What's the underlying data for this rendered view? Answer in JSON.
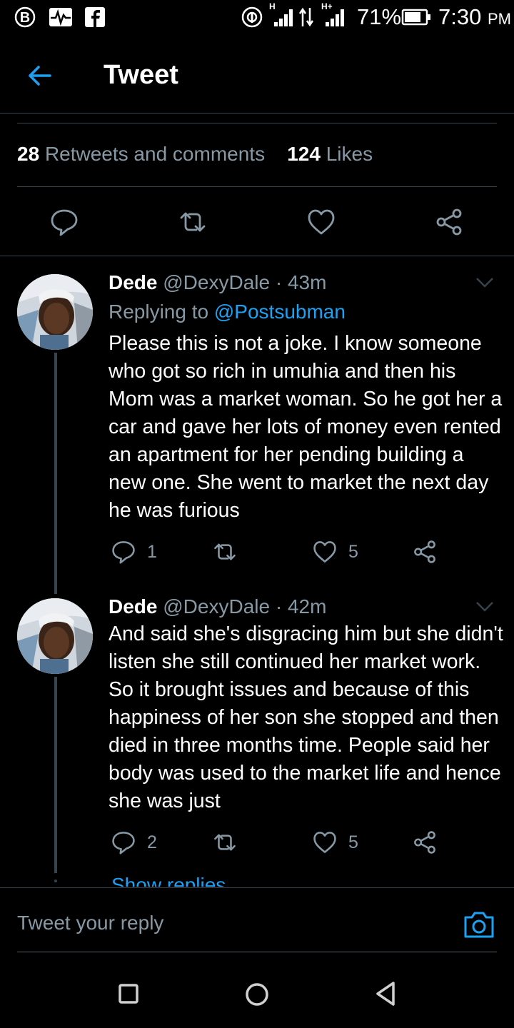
{
  "status_bar": {
    "left_icons": [
      "b-badge-icon",
      "activity-monitor-icon",
      "facebook-icon"
    ],
    "network_labels": [
      "H",
      "H+"
    ],
    "battery": "71%",
    "time": "7:30",
    "ampm": "PM"
  },
  "header": {
    "title": "Tweet"
  },
  "stats": {
    "retweets_count": "28",
    "retweets_label": "Retweets and comments",
    "likes_count": "124",
    "likes_label": "Likes"
  },
  "tweets": [
    {
      "name": "Dede",
      "handle": "@DexyDale",
      "time": "· 43m",
      "replying_prefix": "Replying to",
      "replying_handle": "@Postsubman",
      "text": "Please this is not a joke. I know someone who got so rich in umuhia and then his Mom was a market woman. So he got her a car and gave her lots of money even rented an apartment for her pending building a new one. She went to market the next day he was furious",
      "reply_count": "1",
      "like_count": "5"
    },
    {
      "name": "Dede",
      "handle": "@DexyDale",
      "time": "· 42m",
      "text": "And said she's disgracing him but she didn't listen she still continued her market work. So it brought issues and because of this happiness of her son she stopped and then died in three months time. People said her body was used to the market life and hence she was just",
      "reply_count": "2",
      "like_count": "5"
    }
  ],
  "show_replies": "Show replies",
  "reply_bar": {
    "placeholder": "Tweet your reply"
  },
  "colors": {
    "accent": "#1da1f2",
    "muted": "#8899a6",
    "background": "#000000",
    "divider": "#38444d"
  }
}
